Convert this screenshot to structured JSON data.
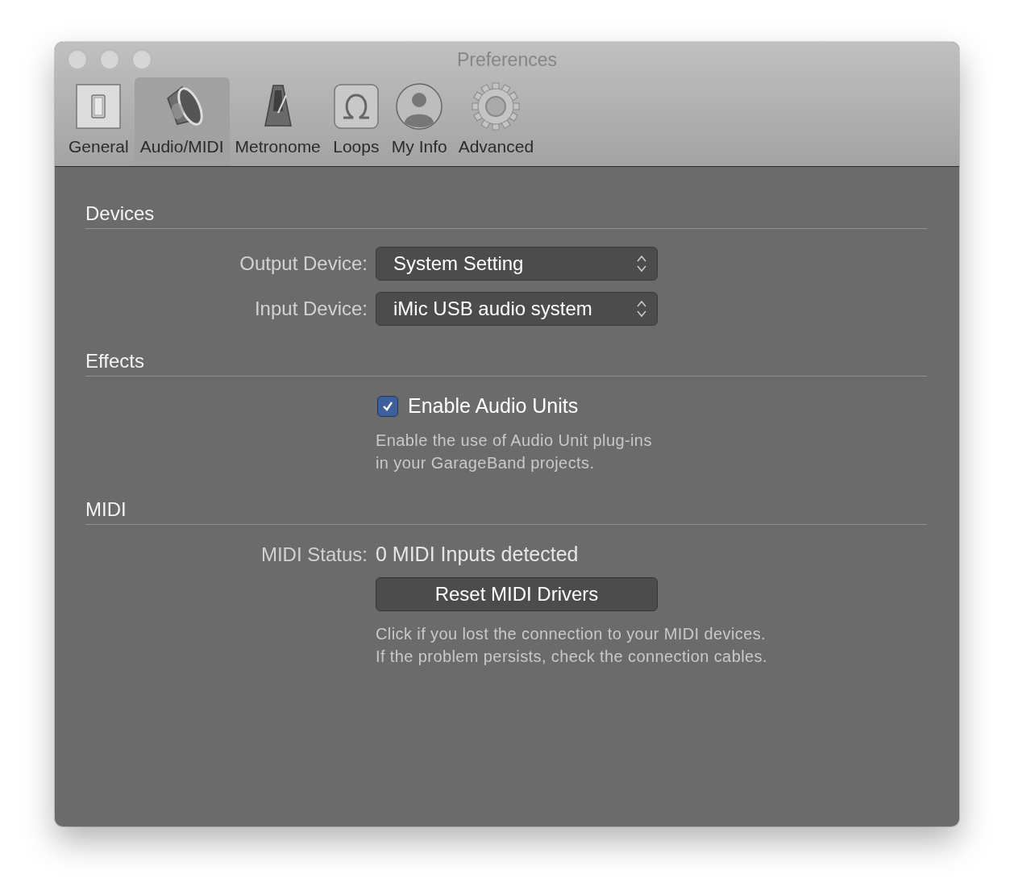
{
  "window": {
    "title": "Preferences"
  },
  "tabs": [
    {
      "label": "General",
      "kind": "switch",
      "selected": false
    },
    {
      "label": "Audio/MIDI",
      "kind": "speaker",
      "selected": true
    },
    {
      "label": "Metronome",
      "kind": "metronome",
      "selected": false
    },
    {
      "label": "Loops",
      "kind": "loop",
      "selected": false
    },
    {
      "label": "My Info",
      "kind": "person",
      "selected": false
    },
    {
      "label": "Advanced",
      "kind": "gear",
      "selected": false
    }
  ],
  "sections": [
    {
      "title": "Devices",
      "rows": [
        {
          "kind": "popup",
          "label": "Output Device:",
          "value": "System Setting"
        },
        {
          "kind": "popup",
          "label": "Input Device:",
          "value": "iMic USB audio system"
        }
      ]
    },
    {
      "title": "Effects",
      "rows": [
        {
          "kind": "checkbox",
          "label": "Enable Audio Units",
          "checked": true
        },
        {
          "kind": "note",
          "lines": [
            "Enable the use of Audio Unit plug-ins",
            "in your GarageBand projects."
          ]
        }
      ]
    },
    {
      "title": "MIDI",
      "rows": [
        {
          "kind": "status",
          "label": "MIDI Status:",
          "value": "0 MIDI Inputs detected"
        },
        {
          "kind": "button",
          "label": "Reset MIDI Drivers"
        },
        {
          "kind": "note",
          "lines": [
            "Click if you lost the connection to your MIDI devices.",
            "If the problem persists, check the connection cables."
          ]
        }
      ]
    }
  ]
}
